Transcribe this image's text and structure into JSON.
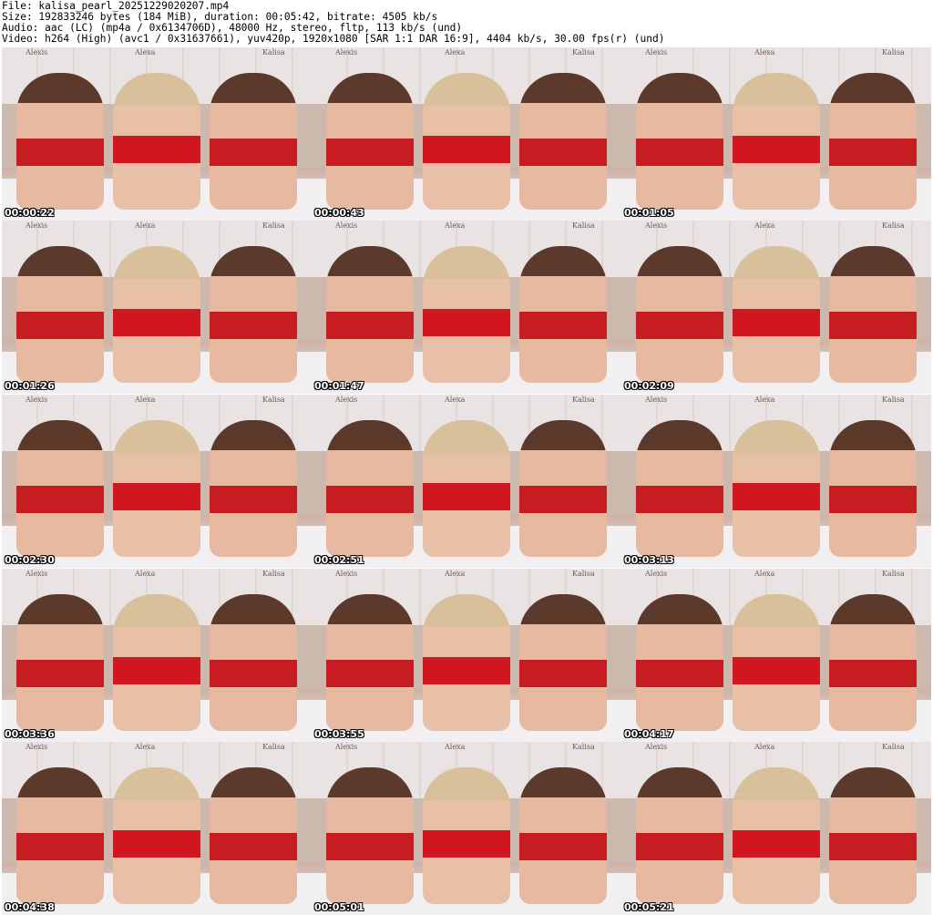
{
  "header": {
    "file": "File: kalisa_pearl_20251229020207.mp4",
    "size": "Size: 192833246 bytes (184 MiB), duration: 00:05:42, bitrate: 4505 kb/s",
    "audio": "Audio: aac (LC) (mp4a / 0x6134706D), 48000 Hz, stereo, fltp, 113 kb/s (und)",
    "video": "Video: h264 (High) (avc1 / 0x31637661), yuv420p, 1920x1080 [SAR 1:1 DAR 16:9], 4404 kb/s, 30.00 fps(r) (und)"
  },
  "name_labels": [
    "Alexis",
    "Alexa",
    "Kalisa"
  ],
  "timestamps": [
    "00:00:22",
    "00:00:43",
    "00:01:05",
    "00:01:26",
    "00:01:47",
    "00:02:09",
    "00:02:30",
    "00:02:51",
    "00:03:13",
    "00:03:36",
    "00:03:55",
    "00:04:17",
    "00:04:38",
    "00:05:01",
    "00:05:21"
  ]
}
